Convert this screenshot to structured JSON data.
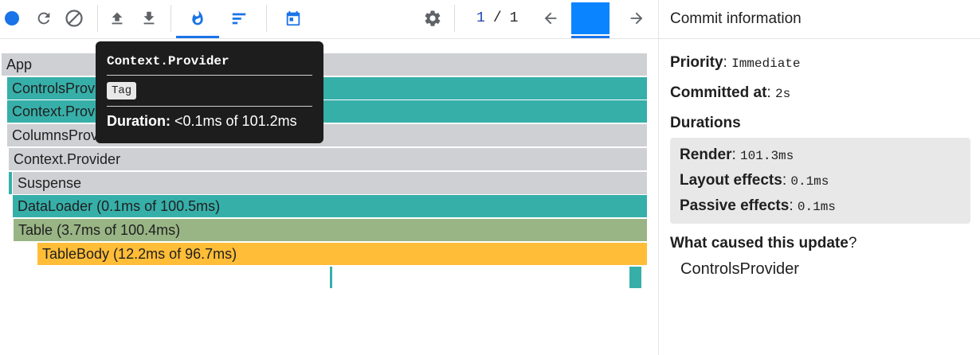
{
  "toolbar": {
    "icons": [
      "record-icon",
      "reload-icon",
      "clear-icon",
      "upload-icon",
      "download-icon",
      "flame-icon",
      "ranked-icon",
      "calendar-icon",
      "gear-icon",
      "arrow-left-icon",
      "arrow-right-icon"
    ],
    "commit_current": "1",
    "commit_sep": "/",
    "commit_total": "1",
    "colors": {
      "accent": "#1a73e8",
      "record": "#1a73e8",
      "icon": "#5f6368"
    }
  },
  "flamegraph": {
    "bars": [
      {
        "label": "App"
      },
      {
        "label": "ControlsProvider (0.1ms of 101.3ms)"
      },
      {
        "label": "Context.Provider (<0.1ms of 101.2ms)"
      },
      {
        "label": "ColumnsProvider"
      },
      {
        "label": "Context.Provider"
      },
      {
        "label": "Suspense"
      },
      {
        "label": "DataLoader (0.1ms of 100.5ms)"
      },
      {
        "label": "Table (3.7ms of 100.4ms)"
      },
      {
        "label": "TableBody (12.2ms of 96.7ms)"
      }
    ],
    "colors": {
      "gray": "#cfd0d4",
      "teal": "#37afa9",
      "olive": "#99b585",
      "yellow": "#ffbd38"
    }
  },
  "tooltip": {
    "title": "Context.Provider",
    "tag": "Tag",
    "duration_label": "Duration:",
    "duration_value": "<0.1ms of 101.2ms"
  },
  "commit_info": {
    "header": "Commit information",
    "priority_label": "Priority",
    "priority_value": "Immediate",
    "committed_label": "Committed at",
    "committed_value": "2s",
    "durations_label": "Durations",
    "render_label": "Render",
    "render_value": "101.3ms",
    "layout_label": "Layout effects",
    "layout_value": "0.1ms",
    "passive_label": "Passive effects",
    "passive_value": "0.1ms",
    "caused_label": "What caused this update",
    "caused_q": "?",
    "caused_value": "ControlsProvider",
    "colon": ":"
  }
}
